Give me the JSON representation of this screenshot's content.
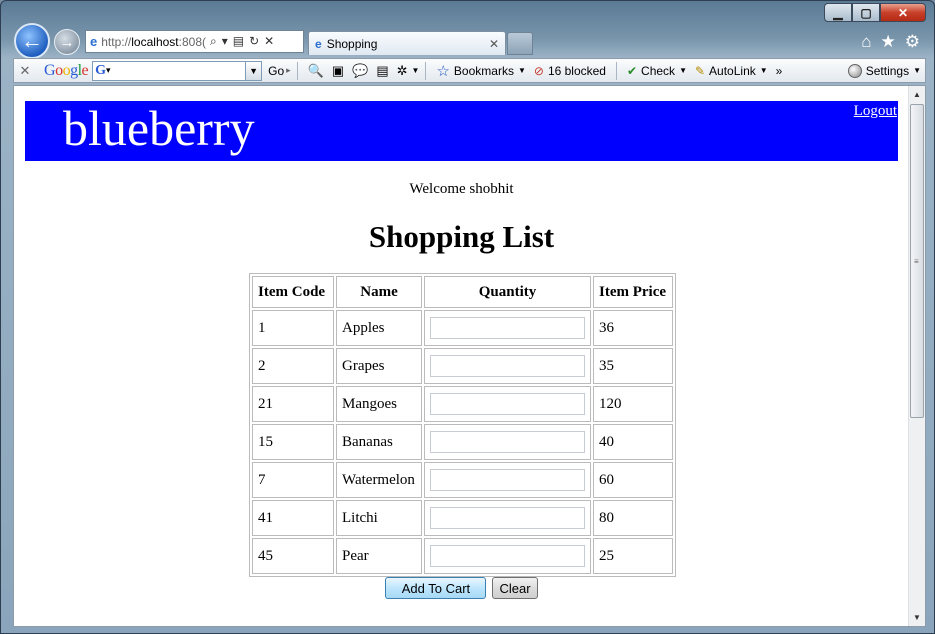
{
  "browser": {
    "address": {
      "prefix": "http://",
      "host": "localhost",
      "port_fragment": ":808("
    },
    "tab": {
      "title": "Shopping"
    }
  },
  "toolbar": {
    "google_logo": [
      "G",
      "o",
      "o",
      "g",
      "l",
      "e"
    ],
    "search_mark": "G",
    "go_label": "Go",
    "bookmarks_label": "Bookmarks",
    "blocked_label": "16 blocked",
    "check_label": "Check",
    "autolink_label": "AutoLink",
    "more_label": "»",
    "settings_label": "Settings"
  },
  "page": {
    "brand": "blueberry",
    "logout_label": "Logout",
    "welcome": "Welcome shobhit",
    "title": "Shopping List",
    "table": {
      "headers": [
        "Item Code",
        "Name",
        "Quantity",
        "Item Price"
      ],
      "rows": [
        {
          "code": "1",
          "name": "Apples",
          "price": "36"
        },
        {
          "code": "2",
          "name": "Grapes",
          "price": "35"
        },
        {
          "code": "21",
          "name": "Mangoes",
          "price": "120"
        },
        {
          "code": "15",
          "name": "Bananas",
          "price": "40"
        },
        {
          "code": "7",
          "name": "Watermelon",
          "price": "60"
        },
        {
          "code": "41",
          "name": "Litchi",
          "price": "80"
        },
        {
          "code": "45",
          "name": "Pear",
          "price": "25"
        }
      ]
    },
    "buttons": {
      "add_to_cart": "Add To Cart",
      "clear": "Clear"
    }
  },
  "colors": {
    "banner": "#0000ff",
    "banner_text": "#ffffff"
  }
}
